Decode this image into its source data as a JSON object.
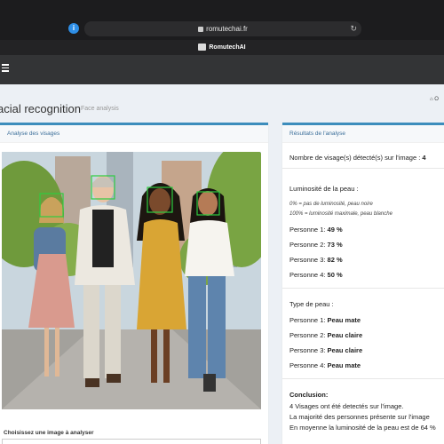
{
  "browser": {
    "url": "romutechai.fr",
    "site_name": "RomutechAI"
  },
  "header": {
    "title": "acial recognition",
    "subtitle": "Face analysis",
    "breadcrumb": "O"
  },
  "left_panel": {
    "title": "Analyse des visages",
    "choose_label": "Choisissez une image à analyser"
  },
  "right_panel": {
    "title": "Résultats de l'analyse",
    "face_count_label": "Nombre de visage(s) détecté(s) sur l'image : ",
    "face_count": "4",
    "luminosity_title": "Luminosité de la peau :",
    "luminosity_note1": "0% = pas de luminosité, peau noire",
    "luminosity_note2": "100% = luminosité maximale, peau blanche",
    "luminosity": [
      {
        "label": "Personne 1: ",
        "value": "49 %"
      },
      {
        "label": "Personne 2: ",
        "value": "73 %"
      },
      {
        "label": "Personne 3: ",
        "value": "82 %"
      },
      {
        "label": "Personne 4: ",
        "value": "50 %"
      }
    ],
    "skin_type_title": "Type de peau :",
    "skin_types": [
      {
        "label": "Personne 1: ",
        "value": "Peau mate"
      },
      {
        "label": "Personne 2: ",
        "value": "Peau claire"
      },
      {
        "label": "Personne 3: ",
        "value": "Peau claire"
      },
      {
        "label": "Personne 4: ",
        "value": "Peau mate"
      }
    ],
    "conclusion_title": "Conclusion:",
    "conclusion_lines": [
      "4 Visages ont été detectés sur l'image.",
      "La majorité des personnes présente sur l'image",
      "En moyenne la luminosité de la peau est de 64 %"
    ]
  },
  "colors": {
    "accent": "#3c8dbc",
    "face_box": "#2ecc40"
  }
}
